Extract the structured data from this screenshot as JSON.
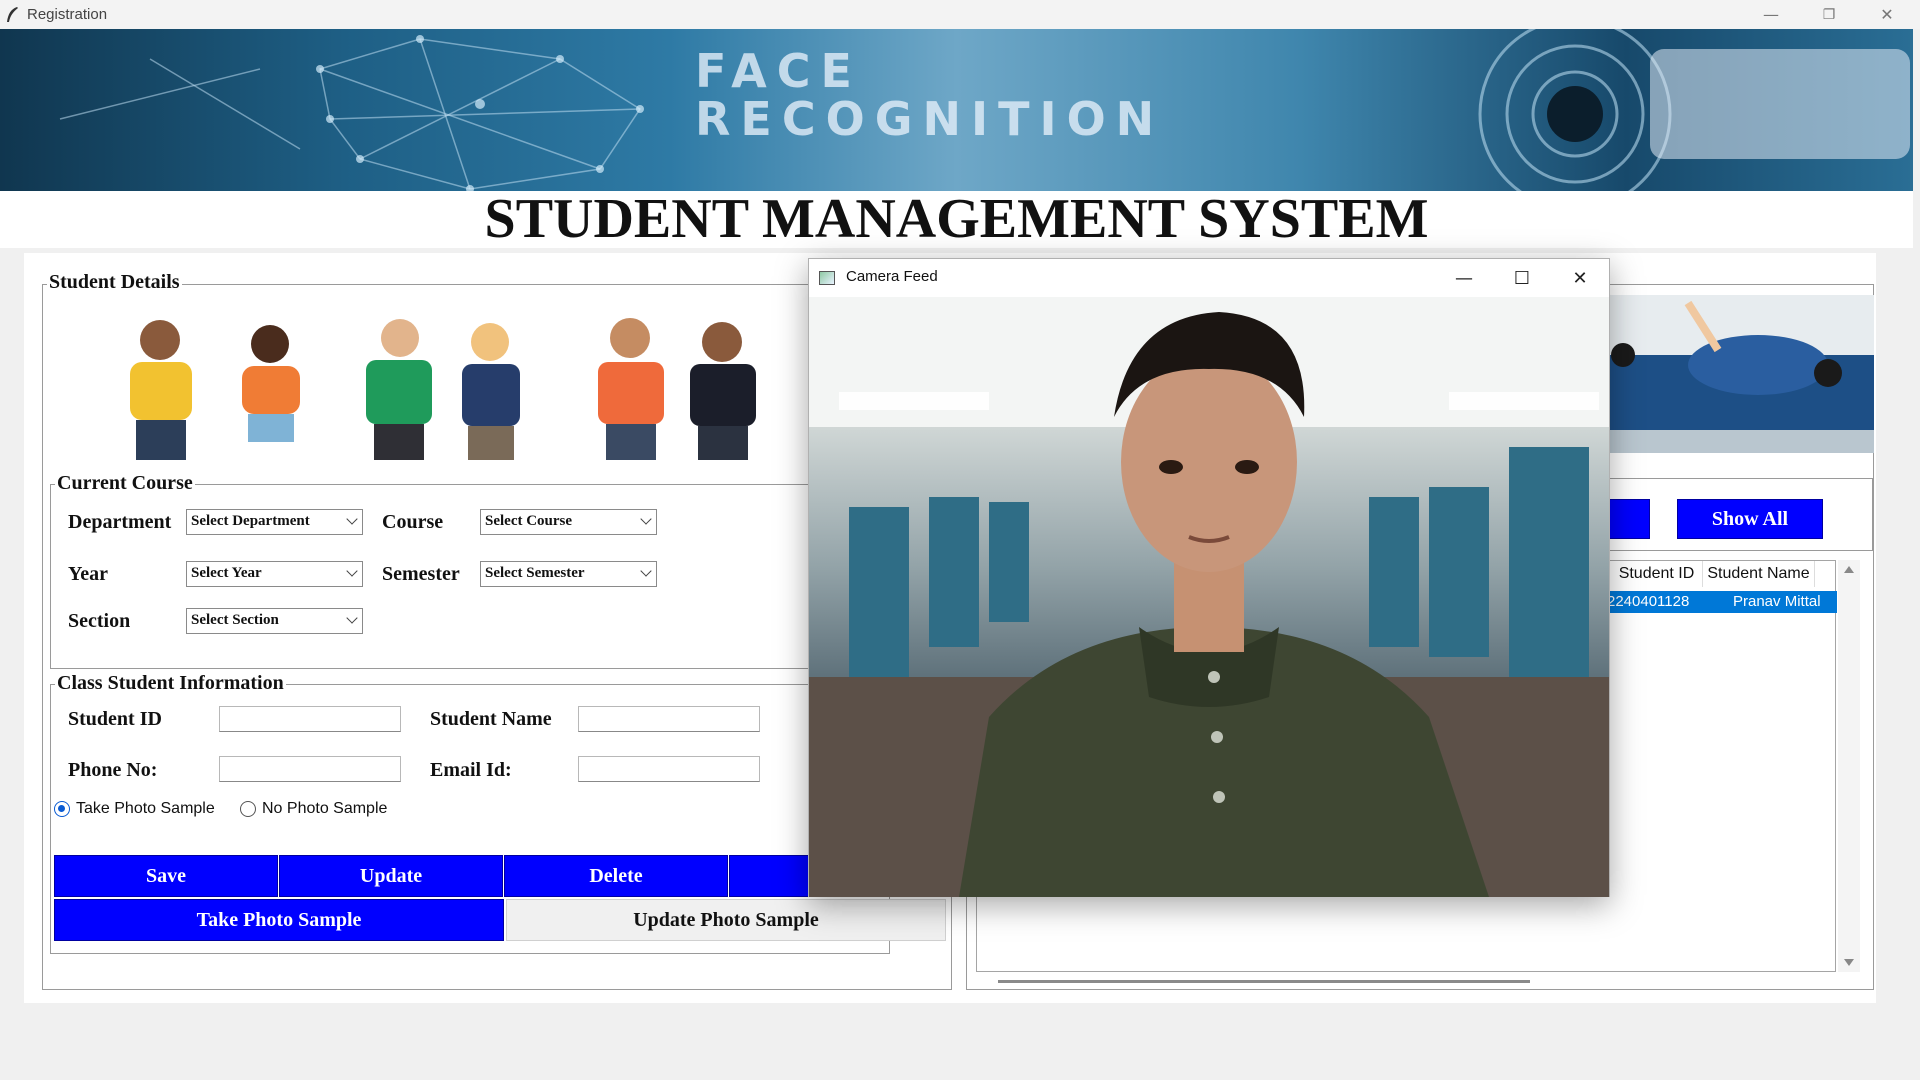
{
  "window": {
    "title": "Registration",
    "minimize": "—",
    "restore": "❐",
    "close": "✕"
  },
  "banner": {
    "text_line1": "FACE",
    "text_line2": "RECOGNITION"
  },
  "heading": "STUDENT MANAGEMENT SYSTEM",
  "student_details": {
    "legend": "Student Details",
    "current_course": {
      "legend": "Current Course",
      "department_label": "Department",
      "department_value": "Select Department",
      "course_label": "Course",
      "course_value": "Select Course",
      "year_label": "Year",
      "year_value": "Select Year",
      "semester_label": "Semester",
      "semester_value": "Select Semester",
      "section_label": "Section",
      "section_value": "Select Section"
    },
    "class_info": {
      "legend": "Class Student Information",
      "student_id_label": "Student ID",
      "student_name_label": "Student Name",
      "phone_label": "Phone No:",
      "email_label": "Email Id:",
      "radio_take": "Take Photo Sample",
      "radio_none": "No Photo Sample"
    },
    "buttons": {
      "save": "Save",
      "update": "Update",
      "delete": "Delete",
      "take_photo": "Take Photo Sample",
      "update_photo": "Update Photo Sample"
    }
  },
  "right_panel": {
    "show_all": "Show All",
    "columns": [
      "Student ID",
      "Student Name"
    ],
    "rows": [
      {
        "student_id": "2240401128",
        "student_name": "Pranav Mittal"
      }
    ]
  },
  "camera": {
    "title": "Camera Feed",
    "minimize": "—",
    "maximize": "☐",
    "close": "✕"
  },
  "colors": {
    "button_blue": "#0000ff",
    "selection_blue": "#0078d7"
  }
}
